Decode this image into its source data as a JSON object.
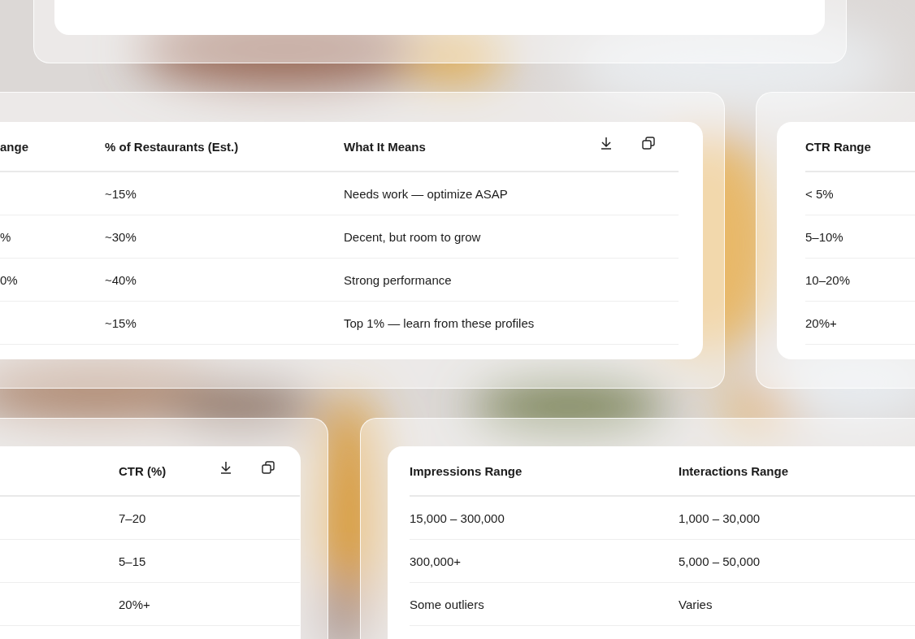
{
  "cards": [
    {
      "kind": "empty"
    },
    {
      "kind": "table",
      "toolbar": true,
      "columns": [
        "ange",
        "% of Restaurants (Est.)",
        "What It Means"
      ],
      "rows": [
        [
          null,
          "~15%",
          "Needs work — optimize ASAP"
        ],
        [
          "%",
          "~30%",
          "Decent, but room to grow"
        ],
        [
          "0%",
          "~40%",
          "Strong performance"
        ],
        [
          null,
          "~15%",
          "Top 1% — learn from these profiles"
        ]
      ]
    },
    {
      "kind": "table",
      "columns": [
        "CTR Range"
      ],
      "rows": [
        [
          "< 5%"
        ],
        [
          "5–10%"
        ],
        [
          "10–20%"
        ],
        [
          "20%+"
        ]
      ]
    },
    {
      "kind": "table",
      "toolbar": true,
      "columns": [
        null,
        "CTR (%)"
      ],
      "rows": [
        [
          null,
          "7–20"
        ],
        [
          null,
          "5–15"
        ],
        [
          null,
          "20%+"
        ],
        [
          null,
          null
        ]
      ]
    },
    {
      "kind": "table",
      "columns": [
        "Impressions Range",
        "Interactions Range"
      ],
      "rows": [
        [
          "15,000 – 300,000",
          "1,000 – 30,000"
        ],
        [
          "300,000+",
          "5,000 – 50,000"
        ],
        [
          "Some outliers",
          "Varies"
        ],
        [
          null,
          null
        ]
      ]
    }
  ]
}
